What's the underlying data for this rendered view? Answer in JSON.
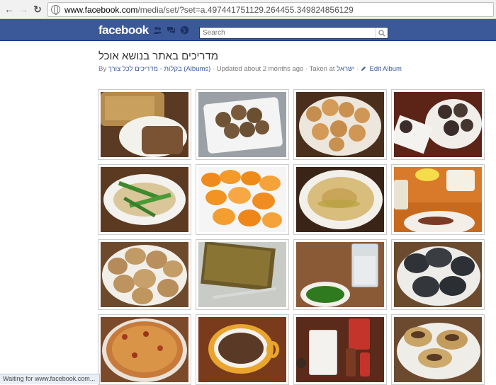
{
  "browser": {
    "url_host": "www.facebook.com",
    "url_path": "/media/set/?set=a.497441751129.264455.349824856129"
  },
  "fb": {
    "logo": "facebook",
    "search_placeholder": "Search"
  },
  "album": {
    "title": "מדריכים באתר בנושא אוכל",
    "by": "By",
    "owner": "בקלות - מדריכים לכל צורך",
    "albums_link": "(Albums)",
    "updated": "· Updated about 2 months ago ·",
    "taken_at_label": "Taken at",
    "location": "ישראל",
    "edit": "Edit Album"
  },
  "photos": [
    {
      "name": "halva-dessert"
    },
    {
      "name": "muffins"
    },
    {
      "name": "cookies"
    },
    {
      "name": "coconut-balls"
    },
    {
      "name": "stir-fry"
    },
    {
      "name": "carrot-slices"
    },
    {
      "name": "hummus"
    },
    {
      "name": "dessert-plate"
    },
    {
      "name": "oat-cookies"
    },
    {
      "name": "cake-slice"
    },
    {
      "name": "water-and-greens"
    },
    {
      "name": "dark-patties"
    },
    {
      "name": "pizza"
    },
    {
      "name": "coffee-cup"
    },
    {
      "name": "milk-glass"
    },
    {
      "name": "filled-pastries"
    }
  ],
  "status_bar": "Waiting for www.facebook.com..."
}
